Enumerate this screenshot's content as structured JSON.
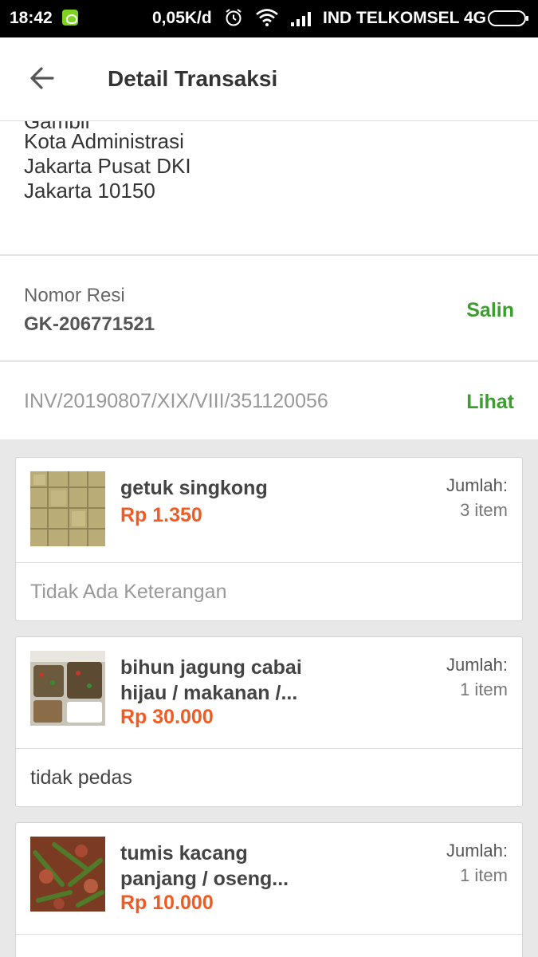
{
  "status_bar": {
    "time": "18:42",
    "speed": "0,05K/d",
    "carrier": "IND TELKOMSEL 4G"
  },
  "app_bar": {
    "title": "Detail Transaksi"
  },
  "address": {
    "lines": [
      "Gambir",
      "Kota Administrasi",
      "Jakarta Pusat DKI",
      "Jakarta 10150"
    ]
  },
  "resi": {
    "label": "Nomor Resi",
    "value": "GK-206771521",
    "action": "Salin"
  },
  "invoice": {
    "number": "INV/20190807/XIX/VIII/351120056",
    "action": "Lihat"
  },
  "products": [
    {
      "name": "getuk singkong",
      "price": "Rp 1.350",
      "qty_label": "Jumlah:",
      "qty": "3 item",
      "note": "Tidak Ada Keterangan"
    },
    {
      "name": "bihun jagung cabai hijau / makanan /...",
      "price": "Rp 30.000",
      "qty_label": "Jumlah:",
      "qty": "1 item",
      "note": "tidak pedas"
    },
    {
      "name": "tumis kacang panjang / oseng...",
      "price": "Rp 10.000",
      "qty_label": "Jumlah:",
      "qty": "1 item",
      "note": ""
    }
  ],
  "colors": {
    "accent_green": "#3b9e2e",
    "price_orange": "#f15a22"
  }
}
